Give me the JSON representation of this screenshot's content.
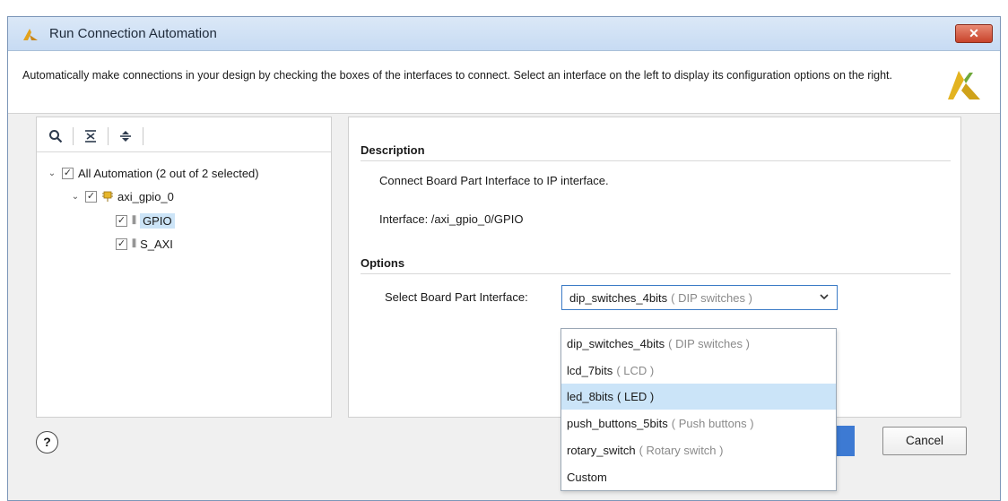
{
  "window": {
    "title": "Run Connection Automation",
    "close_glyph": "✕"
  },
  "header": {
    "description": "Automatically make connections in your design by checking the boxes of the interfaces to connect. Select an interface on the left to display its configuration options on the right."
  },
  "left_panel": {
    "toolbar": [
      "search-icon",
      "collapse-all-icon",
      "expand-all-icon"
    ],
    "tree": {
      "root": {
        "label": "All Automation (2 out of 2 selected)",
        "checked": true
      },
      "ip": {
        "label": "axi_gpio_0",
        "checked": true
      },
      "ports": [
        {
          "label": "GPIO",
          "checked": true,
          "selected": true
        },
        {
          "label": "S_AXI",
          "checked": true,
          "selected": false
        }
      ]
    }
  },
  "right_panel": {
    "description_heading": "Description",
    "description_text": "Connect Board Part Interface to IP interface.",
    "interface_text": "Interface: /axi_gpio_0/GPIO",
    "options_heading": "Options",
    "select_label": "Select Board Part Interface:",
    "select_value": {
      "name": "dip_switches_4bits",
      "desc": "( DIP switches )"
    }
  },
  "dropdown": {
    "items": [
      {
        "name": "dip_switches_4bits",
        "desc": "( DIP switches )"
      },
      {
        "name": "lcd_7bits",
        "desc": "( LCD )"
      },
      {
        "name": "led_8bits",
        "desc": "( LED )"
      },
      {
        "name": "push_buttons_5bits",
        "desc": "( Push buttons )"
      },
      {
        "name": "rotary_switch",
        "desc": "( Rotary switch )"
      },
      {
        "name": "Custom",
        "desc": ""
      }
    ],
    "highlighted_index": 2
  },
  "footer": {
    "help_glyph": "?",
    "cancel_label": "Cancel"
  },
  "colors": {
    "accent_blue": "#3d7ad3",
    "selection": "#cbe4f8",
    "xilinx_logo": "#d6a51a"
  }
}
